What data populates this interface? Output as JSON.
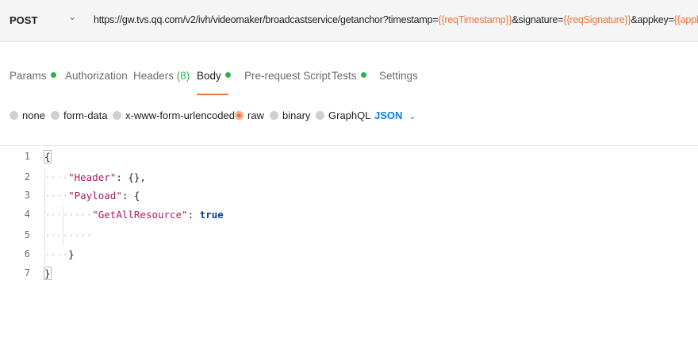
{
  "request": {
    "method": "POST",
    "url_base": "https://gw.tvs.qq.com/v2/ivh/videomaker/broadcastservice/getanchor?timestamp=",
    "var_timestamp": "{{reqTimestamp}}",
    "url_sig": "&signature=",
    "var_signature": "{{reqSignature}}",
    "url_appkey": "&appkey=",
    "var_appkey": "{{appkey}}"
  },
  "tabs": {
    "params": "Params",
    "authorization": "Authorization",
    "headers": "Headers",
    "headers_count": "(8)",
    "body": "Body",
    "prerequest": "Pre-request Script",
    "tests": "Tests",
    "settings": "Settings"
  },
  "body_types": {
    "none": "none",
    "form_data": "form-data",
    "urlencoded": "x-www-form-urlencoded",
    "raw": "raw",
    "binary": "binary",
    "graphql": "GraphQL",
    "selected_format": "JSON"
  },
  "editor": {
    "line_numbers": [
      "1",
      "2",
      "3",
      "4",
      "5",
      "6",
      "7"
    ],
    "open_brace": "{",
    "header_key": "\"Header\"",
    "header_val": ": {},",
    "payload_key": "\"Payload\"",
    "payload_open": ": {",
    "getall_key": "\"GetAllResource\"",
    "colon": ": ",
    "getall_val": "true",
    "inner_close": "}",
    "close_brace": "}"
  },
  "colors": {
    "accent": "#e8743b",
    "active_dot": "#2bb24c",
    "link_blue": "#097bed"
  }
}
